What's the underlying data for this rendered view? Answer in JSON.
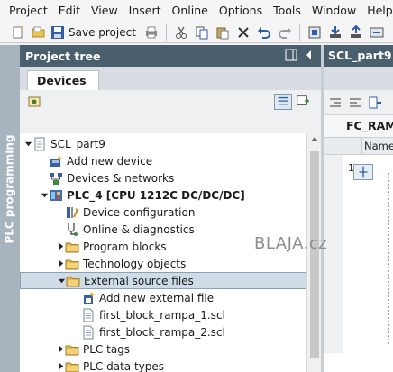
{
  "menu": [
    "Project",
    "Edit",
    "View",
    "Insert",
    "Online",
    "Options",
    "Tools",
    "Window",
    "Help"
  ],
  "toolbar": {
    "save_label": "Save project"
  },
  "sidebar": {
    "vertical_label": "PLC programming"
  },
  "project_tree": {
    "title": "Project tree",
    "tab": "Devices",
    "items": [
      {
        "label": "SCL_part9",
        "indent": 0,
        "expander": "open",
        "icon": "project-icon"
      },
      {
        "label": "Add new device",
        "indent": 1,
        "expander": "none",
        "icon": "add-device-icon"
      },
      {
        "label": "Devices & networks",
        "indent": 1,
        "expander": "none",
        "icon": "network-icon"
      },
      {
        "label": "PLC_4 [CPU 1212C DC/DC/DC]",
        "indent": 1,
        "expander": "open",
        "icon": "plc-icon"
      },
      {
        "label": "Device configuration",
        "indent": 2,
        "expander": "none",
        "icon": "device-config-icon"
      },
      {
        "label": "Online & diagnostics",
        "indent": 2,
        "expander": "none",
        "icon": "diagnostics-icon"
      },
      {
        "label": "Program blocks",
        "indent": 2,
        "expander": "closed",
        "icon": "folder-icon"
      },
      {
        "label": "Technology objects",
        "indent": 2,
        "expander": "closed",
        "icon": "folder-icon"
      },
      {
        "label": "External source files",
        "indent": 2,
        "expander": "open",
        "icon": "folder-icon",
        "selected": true
      },
      {
        "label": "Add new external file",
        "indent": 3,
        "expander": "none",
        "icon": "add-file-icon"
      },
      {
        "label": "first_block_rampa_1.scl",
        "indent": 3,
        "expander": "none",
        "icon": "file-icon"
      },
      {
        "label": "first_block_rampa_2.scl",
        "indent": 3,
        "expander": "none",
        "icon": "file-icon"
      },
      {
        "label": "PLC tags",
        "indent": 2,
        "expander": "closed",
        "icon": "folder-icon"
      },
      {
        "label": "PLC data types",
        "indent": 2,
        "expander": "closed",
        "icon": "folder-icon"
      }
    ]
  },
  "editor": {
    "tab_title": "SCL_part9",
    "block_title": "FC_RAMP",
    "column_header": "Name",
    "line_number": "1"
  },
  "watermark": "BLAJA.cz",
  "colors": {
    "header": "#4a5f6e",
    "strip": "#a8b4bd",
    "selection": "#cfdbe6"
  }
}
